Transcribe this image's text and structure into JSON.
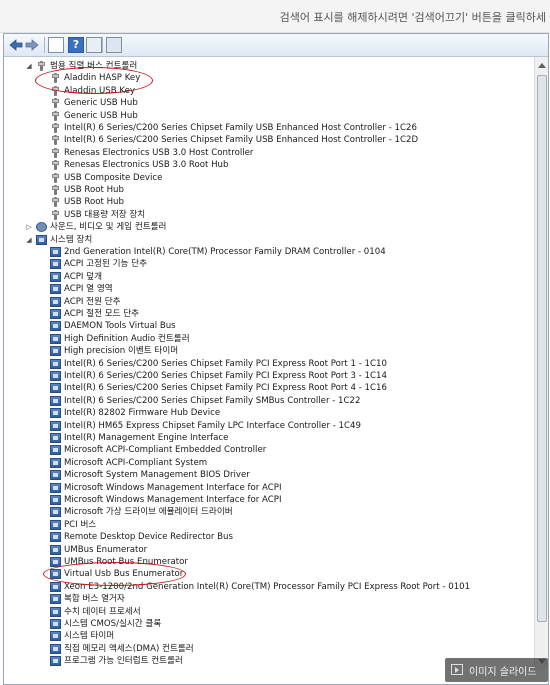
{
  "banner": {
    "notice": "검색어 표시를 해제하시려면 '검색어끄기' 버튼을 클릭하세"
  },
  "toolbar": {
    "back_icon": "back-arrow-icon",
    "forward_icon": "forward-arrow-icon",
    "view_icon": "view-icon",
    "help_icon": "help-icon",
    "help_label": "?",
    "properties_icon": "properties-icon",
    "scan_icon": "scan-hardware-icon"
  },
  "tree": {
    "rows": [
      {
        "level": 0,
        "expand": "open",
        "icon": "usb",
        "label": "범용 직렬 버스 컨트롤러"
      },
      {
        "level": 1,
        "icon": "usb",
        "label": "Aladdin HASP Key"
      },
      {
        "level": 1,
        "icon": "usb",
        "label": "Aladdin USB Key"
      },
      {
        "level": 1,
        "icon": "usb",
        "label": "Generic USB Hub"
      },
      {
        "level": 1,
        "icon": "usb",
        "label": "Generic USB Hub"
      },
      {
        "level": 1,
        "icon": "usb",
        "label": "Intel(R) 6 Series/C200 Series Chipset Family USB Enhanced Host Controller - 1C26"
      },
      {
        "level": 1,
        "icon": "usb",
        "label": "Intel(R) 6 Series/C200 Series Chipset Family USB Enhanced Host Controller - 1C2D"
      },
      {
        "level": 1,
        "icon": "usb",
        "label": "Renesas Electronics USB 3.0 Host Controller"
      },
      {
        "level": 1,
        "icon": "usb",
        "label": "Renesas Electronics USB 3.0 Root Hub"
      },
      {
        "level": 1,
        "icon": "usb",
        "label": "USB Composite Device"
      },
      {
        "level": 1,
        "icon": "usb",
        "label": "USB Root Hub"
      },
      {
        "level": 1,
        "icon": "usb",
        "label": "USB Root Hub"
      },
      {
        "level": 1,
        "icon": "usb",
        "label": "USB 대용량 저장 장치"
      },
      {
        "level": 0,
        "expand": "closed",
        "icon": "sound",
        "label": "사운드, 비디오 및 게임 컨트롤러"
      },
      {
        "level": 0,
        "expand": "open",
        "icon": "sys",
        "label": "시스템 장치"
      },
      {
        "level": 1,
        "icon": "sys",
        "label": "2nd Generation Intel(R) Core(TM) Processor Family DRAM Controller - 0104"
      },
      {
        "level": 1,
        "icon": "sys",
        "label": "ACPI 고정된 기능 단추"
      },
      {
        "level": 1,
        "icon": "sys",
        "label": "ACPI 덮개"
      },
      {
        "level": 1,
        "icon": "sys",
        "label": "ACPI 열 영역"
      },
      {
        "level": 1,
        "icon": "sys",
        "label": "ACPI 전원 단추"
      },
      {
        "level": 1,
        "icon": "sys",
        "label": "ACPI 절전 모드 단추"
      },
      {
        "level": 1,
        "icon": "sys",
        "label": "DAEMON Tools Virtual Bus"
      },
      {
        "level": 1,
        "icon": "sys",
        "label": "High Definition Audio 컨트롤러"
      },
      {
        "level": 1,
        "icon": "sys",
        "label": "High precision 이벤트 타이머"
      },
      {
        "level": 1,
        "icon": "sys",
        "label": "Intel(R) 6 Series/C200 Series Chipset Family PCI Express Root Port 1 - 1C10"
      },
      {
        "level": 1,
        "icon": "sys",
        "label": "Intel(R) 6 Series/C200 Series Chipset Family PCI Express Root Port 3 - 1C14"
      },
      {
        "level": 1,
        "icon": "sys",
        "label": "Intel(R) 6 Series/C200 Series Chipset Family PCI Express Root Port 4 - 1C16"
      },
      {
        "level": 1,
        "icon": "sys",
        "label": "Intel(R) 6 Series/C200 Series Chipset Family SMBus Controller - 1C22"
      },
      {
        "level": 1,
        "icon": "sys",
        "label": "Intel(R) 82802 Firmware Hub Device"
      },
      {
        "level": 1,
        "icon": "sys",
        "label": "Intel(R) HM65 Express Chipset Family LPC Interface Controller - 1C49"
      },
      {
        "level": 1,
        "icon": "sys",
        "label": "Intel(R) Management Engine Interface"
      },
      {
        "level": 1,
        "icon": "sys",
        "label": "Microsoft ACPI-Compliant Embedded Controller"
      },
      {
        "level": 1,
        "icon": "sys",
        "label": "Microsoft ACPI-Compliant System"
      },
      {
        "level": 1,
        "icon": "sys",
        "label": "Microsoft System Management BIOS Driver"
      },
      {
        "level": 1,
        "icon": "sys",
        "label": "Microsoft Windows Management Interface for ACPI"
      },
      {
        "level": 1,
        "icon": "sys",
        "label": "Microsoft Windows Management Interface for ACPI"
      },
      {
        "level": 1,
        "icon": "sys",
        "label": "Microsoft 가상 드라이브 에뮬레이터 드라이버"
      },
      {
        "level": 1,
        "icon": "sys",
        "label": "PCI 버스"
      },
      {
        "level": 1,
        "icon": "sys",
        "label": "Remote Desktop Device Redirector Bus"
      },
      {
        "level": 1,
        "icon": "sys",
        "label": "UMBus Enumerator"
      },
      {
        "level": 1,
        "icon": "sys",
        "label": "UMBus Root Bus Enumerator"
      },
      {
        "level": 1,
        "icon": "sys",
        "label": "Virtual Usb Bus Enumerator"
      },
      {
        "level": 1,
        "icon": "sys",
        "label": "Xeon E3-1200/2nd Generation Intel(R) Core(TM) Processor Family PCI Express Root Port - 0101"
      },
      {
        "level": 1,
        "icon": "sys",
        "label": "복합 버스 열거자"
      },
      {
        "level": 1,
        "icon": "sys",
        "label": "수치 데이터 프로세서"
      },
      {
        "level": 1,
        "icon": "sys",
        "label": "시스템 CMOS/실시간 클록"
      },
      {
        "level": 1,
        "icon": "sys",
        "label": "시스템 타이머"
      },
      {
        "level": 1,
        "icon": "sys",
        "label": "직접 메모리 액세스(DMA) 컨트롤러"
      },
      {
        "level": 1,
        "icon": "sys",
        "label": "프로그램 가능 인터럽트 컨트롤러"
      }
    ]
  },
  "highlights": {
    "color": "#c4161c",
    "circled_rows": [
      "Aladdin HASP Key",
      "Aladdin USB Key",
      "Virtual Usb Bus Enumerator"
    ]
  },
  "slideshow": {
    "icon": "slideshow-icon",
    "label": "이미지 슬라이드"
  }
}
